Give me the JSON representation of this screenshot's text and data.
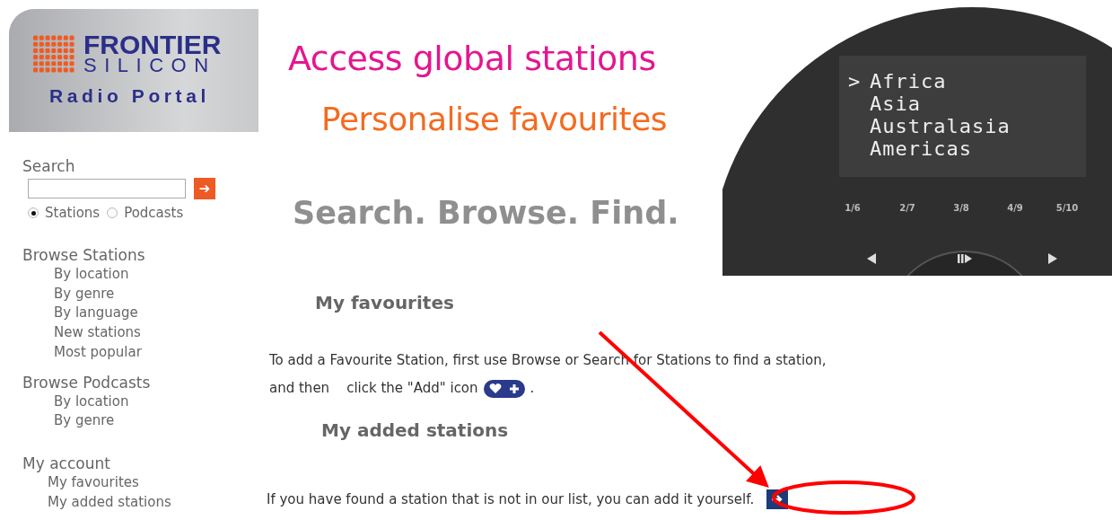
{
  "logo": {
    "brand": "FRONTIER",
    "sub_brand": "SILICON",
    "product": "Radio Portal"
  },
  "sidebar": {
    "search": {
      "label": "Search",
      "go_label": "➔",
      "scopes": [
        {
          "label": "Stations",
          "selected": true
        },
        {
          "label": "Podcasts",
          "selected": false
        }
      ]
    },
    "sections": [
      {
        "title": "Browse Stations",
        "items": [
          "By location",
          "By genre",
          "By language",
          "New stations",
          "Most popular"
        ]
      },
      {
        "title": "Browse Podcasts",
        "items": [
          "By location",
          "By genre"
        ]
      },
      {
        "title": "My account",
        "items": [
          "My favourites",
          "My added stations"
        ]
      }
    ]
  },
  "taglines": [
    "Access global stations",
    "Personalise favourites",
    "Search. Browse. Find."
  ],
  "radio": {
    "menu": [
      {
        "label": "Africa",
        "selected": true
      },
      {
        "label": "Asia",
        "selected": false
      },
      {
        "label": "Australasia",
        "selected": false
      },
      {
        "label": "Americas",
        "selected": false
      }
    ],
    "cursor": ">",
    "presets": [
      "1/6",
      "2/7",
      "3/8",
      "4/9",
      "5/10"
    ]
  },
  "favourites": {
    "heading": "My favourites",
    "line_1": "To add a Favourite Station, first use Browse or Search for Stations to find a station,",
    "line_2": "and then    click the \"Add\" icon",
    "line_2_end": "."
  },
  "added": {
    "heading": "My added stations",
    "text": "If you have found a station that is not in our list, you can add it yourself."
  }
}
